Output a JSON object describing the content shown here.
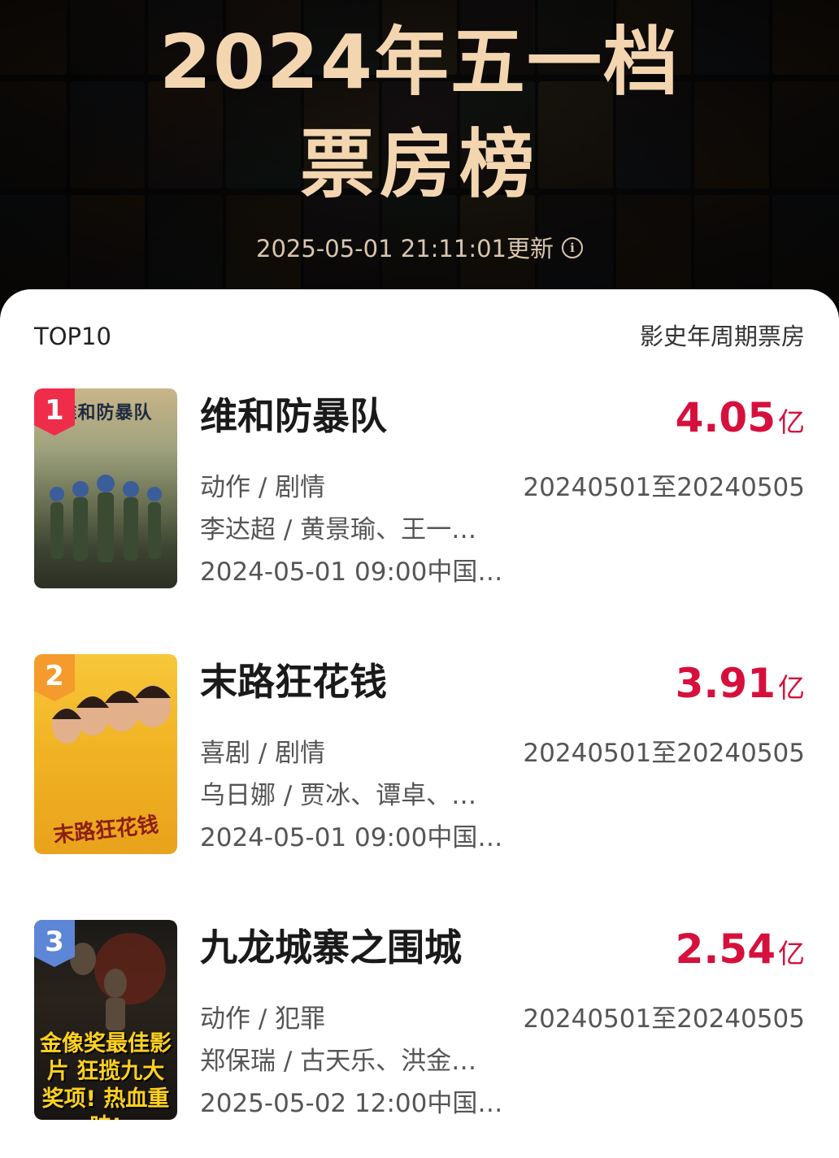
{
  "header": {
    "title_line1": "2024年五一档",
    "title_line2": "票房榜",
    "update_text": "2025-05-01 21:11:01更新",
    "info_icon": "info-icon"
  },
  "list": {
    "left_label": "TOP10",
    "right_label": "影史年周期票房"
  },
  "movies": [
    {
      "rank": "1",
      "title": "维和防暴队",
      "box_value": "4.05",
      "box_unit": "亿",
      "genre": "动作 / 剧情",
      "cast": "李达超 / 黄景瑜、王一…",
      "release": "2024-05-01 09:00中国…",
      "period": "20240501至20240505",
      "poster_text": "维和防暴队",
      "badge_color": "#ef2d4a"
    },
    {
      "rank": "2",
      "title": "末路狂花钱",
      "box_value": "3.91",
      "box_unit": "亿",
      "genre": "喜剧 / 剧情",
      "cast": "乌日娜 / 贾冰、谭卓、…",
      "release": "2024-05-01 09:00中国…",
      "period": "20240501至20240505",
      "poster_text": "末路狂花钱",
      "badge_color": "#f59a2c"
    },
    {
      "rank": "3",
      "title": "九龙城寨之围城",
      "box_value": "2.54",
      "box_unit": "亿",
      "genre": "动作 / 犯罪",
      "cast": "郑保瑞 / 古天乐、洪金…",
      "release": "2025-05-02 12:00中国…",
      "period": "20240501至20240505",
      "poster_text": "金像奖最佳影片 狂揽九大奖项! 热血重映!",
      "badge_color": "#5d86d6"
    }
  ],
  "colors": {
    "accent_red": "#d6103c",
    "title_gold": "#f3d6b0"
  }
}
